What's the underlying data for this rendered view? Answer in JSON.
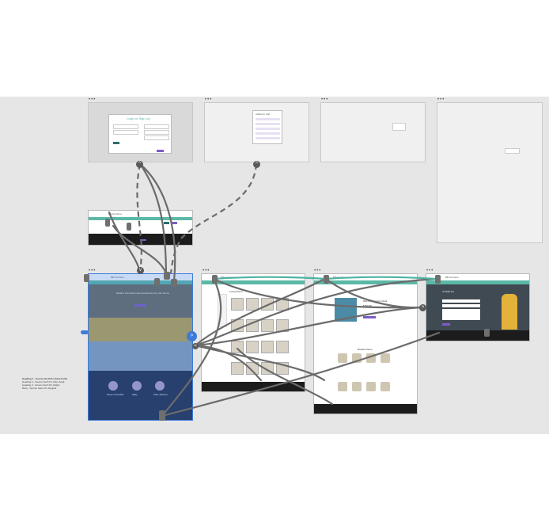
{
  "canvas": {
    "background": "#e6e6e6",
    "artboard_menu_glyph": "•••"
  },
  "overlay_pages": {
    "login": {
      "title": "Login or Sign Up",
      "button": "Submit"
    },
    "cart_dropdown": {
      "title": "Added to Cart"
    }
  },
  "site": {
    "logo_text": "BB Furniture",
    "home_hero_text": "Modern Furnitures and Accessories for your Home",
    "home_cta": "SHOP NOW",
    "team_members": [
      "Naomi Chandler",
      "Sally",
      "Kate Jackson"
    ],
    "category_heading": "Living Room",
    "product_name": "Mid-Century Arm Chair",
    "product_price": "$299.99",
    "add_to_cart": "Add to Cart",
    "related_heading": "Related Items",
    "contact_heading": "Contact Us"
  },
  "notes": {
    "heading1": "Heading 1 - Source Serif Pro (blue bold)",
    "heading2": "Heading 2 - Source Serif Pro (blue bold)",
    "heading3": "Heading 3 - Source Serif Pro (Italic)",
    "body": "Body - Source Sans Pro Regular"
  },
  "colors": {
    "teal": "#5cb8a6",
    "selection": "#3d7bd9",
    "wire": "#6b6b6b",
    "purple": "#7e5bc6"
  }
}
